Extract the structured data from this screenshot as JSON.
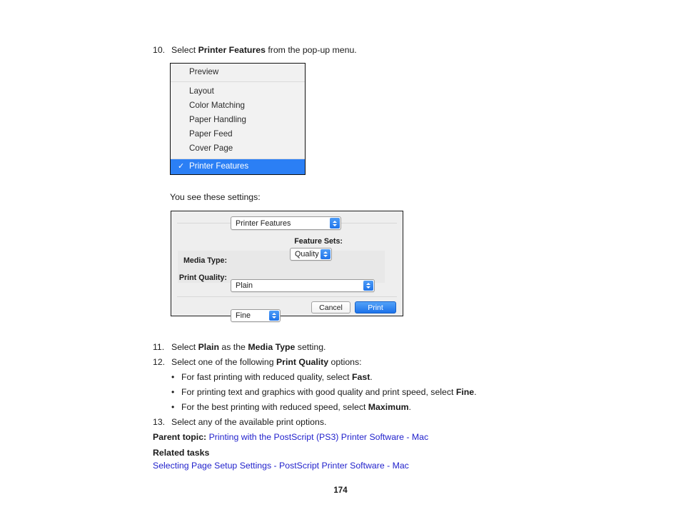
{
  "steps": {
    "step10": {
      "num": "10.",
      "pre": "Select ",
      "bold": "Printer Features",
      "post": " from the pop-up menu."
    },
    "settings_intro": "You see these settings:",
    "step11": {
      "num": "11.",
      "pre": "Select ",
      "bold1": "Plain",
      "mid": " as the ",
      "bold2": "Media Type",
      "post": " setting."
    },
    "step12": {
      "num": "12.",
      "pre": "Select one of the following ",
      "bold": "Print Quality",
      "post": " options:"
    },
    "bullets": [
      {
        "dot": "•",
        "pre": "For fast printing with reduced quality, select ",
        "bold": "Fast",
        "post": "."
      },
      {
        "dot": "•",
        "pre": "For printing text and graphics with good quality and print speed, select ",
        "bold": "Fine",
        "post": "."
      },
      {
        "dot": "•",
        "pre": "For the best printing with reduced speed, select ",
        "bold": "Maximum",
        "post": "."
      }
    ],
    "step13": {
      "num": "13.",
      "text": "Select any of the available print options."
    }
  },
  "footer": {
    "parent_topic_label": "Parent topic:",
    "parent_topic_link": "Printing with the PostScript (PS3) Printer Software - Mac",
    "related_tasks_label": "Related tasks",
    "related_task_link": "Selecting Page Setup Settings - PostScript Printer Software - Mac",
    "page_number": "174"
  },
  "popup_menu": {
    "preview_item": "Preview",
    "items": [
      "Layout",
      "Color Matching",
      "Paper Handling",
      "Paper Feed",
      "Cover Page"
    ],
    "selected_item": "Printer Features",
    "checkmark": "✓",
    "highlight_color": "#2b7ff5"
  },
  "print_dialog": {
    "pane_popup_value": "Printer Features",
    "feature_sets_label": "Feature Sets:",
    "feature_sets_value": "Quality",
    "media_type_label": "Media Type:",
    "media_type_value": "Plain",
    "print_quality_label": "Print Quality:",
    "print_quality_value": "Fine",
    "cancel_label": "Cancel",
    "print_label": "Print",
    "accent_color": "#1c72ea"
  }
}
